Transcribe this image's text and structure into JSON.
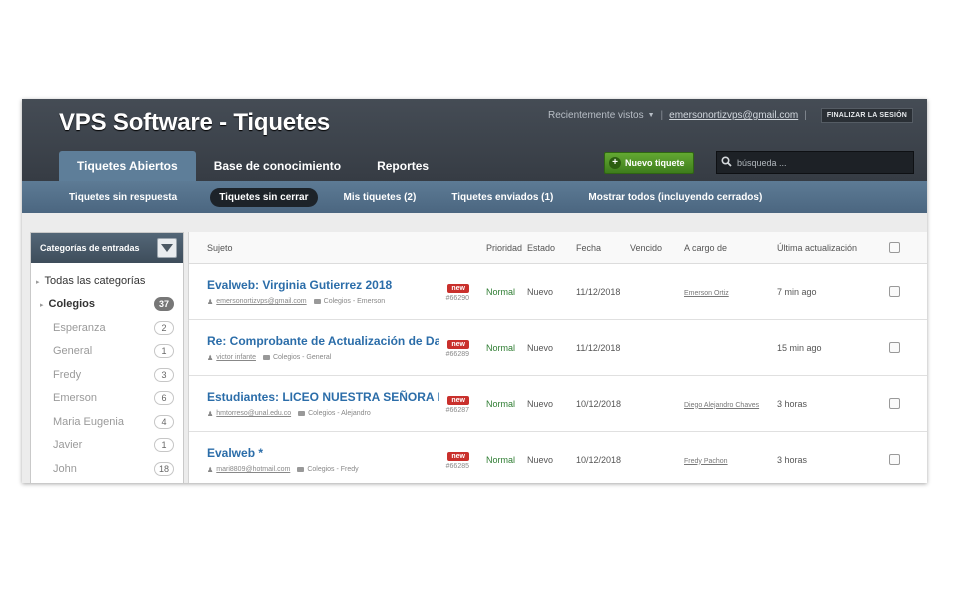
{
  "header": {
    "title": "VPS Software - Tiquetes",
    "recent_label": "Recientemente vistos",
    "separator": "|",
    "user_email": "emersonortizvps@gmail.com",
    "logout_label": "FINALIZAR LA SESIÓN",
    "tabs": [
      {
        "label": "Tiquetes Abiertos",
        "active": true
      },
      {
        "label": "Base de conocimiento",
        "active": false
      },
      {
        "label": "Reportes",
        "active": false
      }
    ],
    "new_ticket_label": "Nuevo tiquete",
    "search_placeholder": "búsqueda ..."
  },
  "subnav": [
    {
      "label": "Tiquetes sin respuesta",
      "active": false
    },
    {
      "label": "Tiquetes sin cerrar",
      "active": true
    },
    {
      "label": "Mis tiquetes (2)",
      "active": false
    },
    {
      "label": "Tiquetes enviados (1)",
      "active": false
    },
    {
      "label": "Mostrar todos (incluyendo cerrados)",
      "active": false
    }
  ],
  "sidebar": {
    "title": "Categorías de entradas",
    "all_label": "Todas las categorías",
    "parent": {
      "name": "Colegios",
      "count": "37"
    },
    "children": [
      {
        "name": "Esperanza",
        "count": "2"
      },
      {
        "name": "General",
        "count": "1"
      },
      {
        "name": "Fredy",
        "count": "3"
      },
      {
        "name": "Emerson",
        "count": "6"
      },
      {
        "name": "Maria Eugenia",
        "count": "4"
      },
      {
        "name": "Javier",
        "count": "1"
      },
      {
        "name": "John",
        "count": "18"
      }
    ]
  },
  "table": {
    "columns": {
      "subject": "Sujeto",
      "priority": "Prioridad",
      "status": "Estado",
      "date": "Fecha",
      "due": "Vencido",
      "assigned": "A cargo de",
      "updated": "Última actualización"
    },
    "rows": [
      {
        "subject": "Evalweb: Virginia Gutierrez 2018",
        "user": "emersonortizvps@gmail.com",
        "category": "Colegios - Emerson",
        "badge": "new",
        "number": "#66290",
        "priority": "Normal",
        "status": "Nuevo",
        "date": "11/12/2018",
        "due": "",
        "assigned": "Emerson Ortiz",
        "updated": "7 min ago"
      },
      {
        "subject": "Re: Comprobante de Actualización de Dato",
        "user": "victor infante",
        "category": "Colegios - General",
        "badge": "new",
        "number": "#66289",
        "priority": "Normal",
        "status": "Nuevo",
        "date": "11/12/2018",
        "due": "",
        "assigned": "",
        "updated": "15 min ago"
      },
      {
        "subject": "Estudiantes: LICEO NUESTRA SEÑORA DE",
        "user": "hmtorreso@unal.edu.co",
        "category": "Colegios - Alejandro",
        "badge": "new",
        "number": "#66287",
        "priority": "Normal",
        "status": "Nuevo",
        "date": "10/12/2018",
        "due": "",
        "assigned": "Diego Alejandro Chaves",
        "updated": "3 horas"
      },
      {
        "subject": "Evalweb *",
        "user": "mari8809@hotmail.com",
        "category": "Colegios - Fredy",
        "badge": "new",
        "number": "#66285",
        "priority": "Normal",
        "status": "Nuevo",
        "date": "10/12/2018",
        "due": "",
        "assigned": "Fredy Pachon",
        "updated": "3 horas"
      }
    ]
  },
  "icons": {
    "search": "search-icon",
    "filter": "filter-icon",
    "plus": "plus-icon"
  },
  "colors": {
    "header_bg": "#3d434b",
    "subnav_bg": "#56728c",
    "accent_green": "#4f9428",
    "link_blue": "#2b6da9",
    "badge_red": "#c9302c",
    "priority_green": "#2e7d32"
  }
}
